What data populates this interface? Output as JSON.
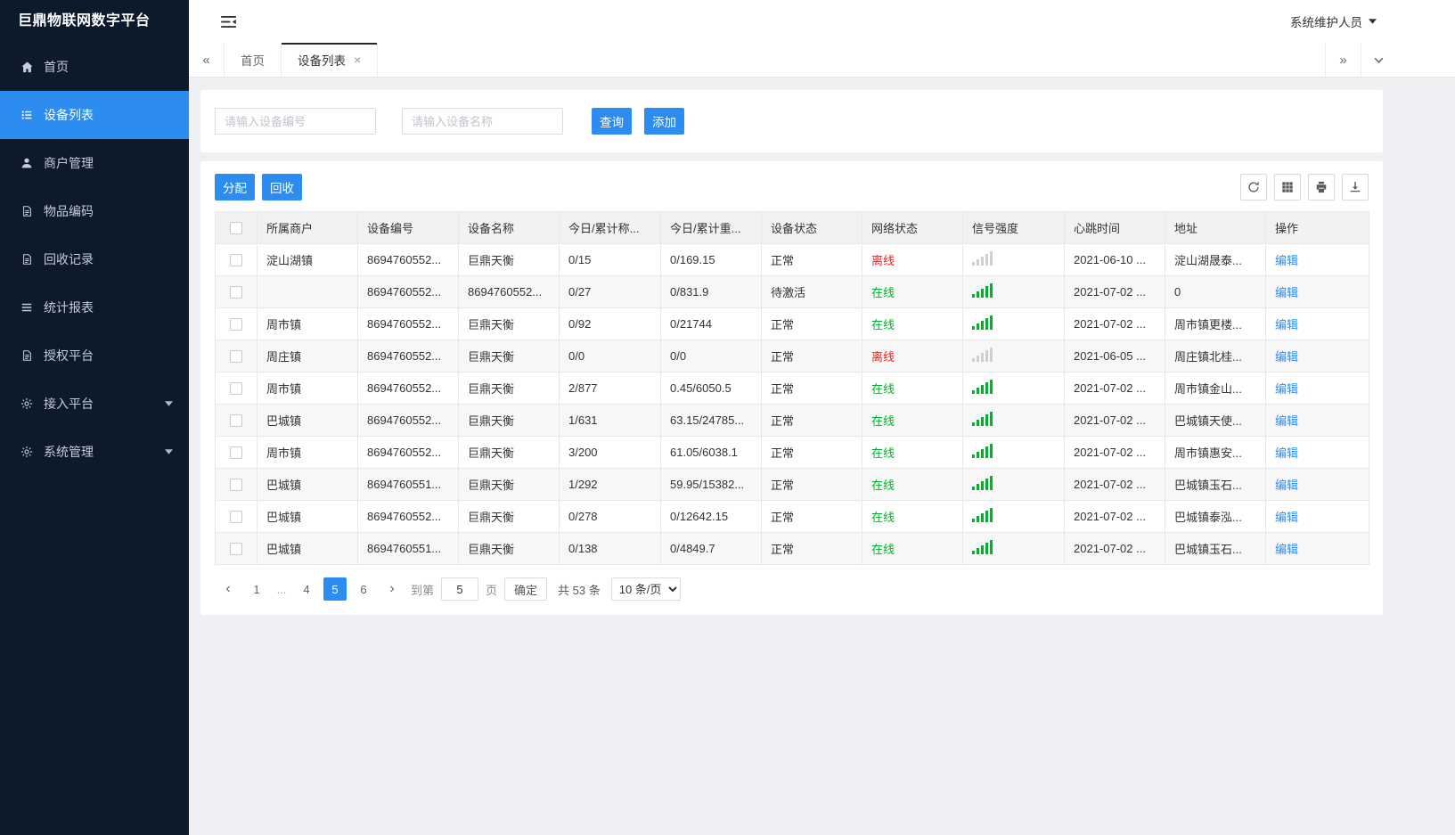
{
  "colors": {
    "accent": "#2d8cf0",
    "online": "#00b42a",
    "offline": "#ff1a1a",
    "sidebar_bg": "#0c1a2c"
  },
  "app": {
    "title": "巨鼎物联网数字平台",
    "user": "系统维护人员"
  },
  "sidebar": {
    "items": [
      {
        "label": "首页",
        "icon": "home",
        "active": false,
        "expandable": false
      },
      {
        "label": "设备列表",
        "icon": "list",
        "active": true,
        "expandable": false
      },
      {
        "label": "商户管理",
        "icon": "user",
        "active": false,
        "expandable": false
      },
      {
        "label": "物品编码",
        "icon": "doc",
        "active": false,
        "expandable": false
      },
      {
        "label": "回收记录",
        "icon": "doc",
        "active": false,
        "expandable": false
      },
      {
        "label": "统计报表",
        "icon": "lines",
        "active": false,
        "expandable": false
      },
      {
        "label": "授权平台",
        "icon": "doc",
        "active": false,
        "expandable": false
      },
      {
        "label": "接入平台",
        "icon": "gear",
        "active": false,
        "expandable": true
      },
      {
        "label": "系统管理",
        "icon": "gear",
        "active": false,
        "expandable": true
      }
    ]
  },
  "tabs": [
    {
      "label": "首页",
      "active": false,
      "closable": false
    },
    {
      "label": "设备列表",
      "active": true,
      "closable": true
    }
  ],
  "search": {
    "device_no_placeholder": "请输入设备编号",
    "device_name_placeholder": "请输入设备名称",
    "query_label": "查询",
    "add_label": "添加"
  },
  "toolbar": {
    "assign_label": "分配",
    "recycle_label": "回收",
    "icons": [
      "refresh",
      "columns",
      "print",
      "export"
    ]
  },
  "table": {
    "columns": [
      "所属商户",
      "设备编号",
      "设备名称",
      "今日/累计称...",
      "今日/累计重...",
      "设备状态",
      "网络状态",
      "信号强度",
      "心跳时间",
      "地址",
      "操作"
    ],
    "rows": [
      {
        "merchant": "淀山湖镇",
        "device_no": "8694760552...",
        "device_name": "巨鼎天衡",
        "count": "0/15",
        "weight": "0/169.15",
        "status": "正常",
        "network": "离线",
        "online": false,
        "heartbeat": "2021-06-10 ...",
        "address": "淀山湖晟泰...",
        "action": "编辑"
      },
      {
        "merchant": "",
        "device_no": "8694760552...",
        "device_name": "8694760552...",
        "count": "0/27",
        "weight": "0/831.9",
        "status": "待激活",
        "network": "在线",
        "online": true,
        "heartbeat": "2021-07-02 ...",
        "address": "0",
        "action": "编辑"
      },
      {
        "merchant": "周市镇",
        "device_no": "8694760552...",
        "device_name": "巨鼎天衡",
        "count": "0/92",
        "weight": "0/21744",
        "status": "正常",
        "network": "在线",
        "online": true,
        "heartbeat": "2021-07-02 ...",
        "address": "周市镇更楼...",
        "action": "编辑"
      },
      {
        "merchant": "周庄镇",
        "device_no": "8694760552...",
        "device_name": "巨鼎天衡",
        "count": "0/0",
        "weight": "0/0",
        "status": "正常",
        "network": "离线",
        "online": false,
        "heartbeat": "2021-06-05 ...",
        "address": "周庄镇北桂...",
        "action": "编辑"
      },
      {
        "merchant": "周市镇",
        "device_no": "8694760552...",
        "device_name": "巨鼎天衡",
        "count": "2/877",
        "weight": "0.45/6050.5",
        "status": "正常",
        "network": "在线",
        "online": true,
        "heartbeat": "2021-07-02 ...",
        "address": "周市镇金山...",
        "action": "编辑"
      },
      {
        "merchant": "巴城镇",
        "device_no": "8694760552...",
        "device_name": "巨鼎天衡",
        "count": "1/631",
        "weight": "63.15/24785...",
        "status": "正常",
        "network": "在线",
        "online": true,
        "heartbeat": "2021-07-02 ...",
        "address": "巴城镇天使...",
        "action": "编辑"
      },
      {
        "merchant": "周市镇",
        "device_no": "8694760552...",
        "device_name": "巨鼎天衡",
        "count": "3/200",
        "weight": "61.05/6038.1",
        "status": "正常",
        "network": "在线",
        "online": true,
        "heartbeat": "2021-07-02 ...",
        "address": "周市镇惠安...",
        "action": "编辑"
      },
      {
        "merchant": "巴城镇",
        "device_no": "8694760551...",
        "device_name": "巨鼎天衡",
        "count": "1/292",
        "weight": "59.95/15382...",
        "status": "正常",
        "network": "在线",
        "online": true,
        "heartbeat": "2021-07-02 ...",
        "address": "巴城镇玉石...",
        "action": "编辑"
      },
      {
        "merchant": "巴城镇",
        "device_no": "8694760552...",
        "device_name": "巨鼎天衡",
        "count": "0/278",
        "weight": "0/12642.15",
        "status": "正常",
        "network": "在线",
        "online": true,
        "heartbeat": "2021-07-02 ...",
        "address": "巴城镇泰泓...",
        "action": "编辑"
      },
      {
        "merchant": "巴城镇",
        "device_no": "8694760551...",
        "device_name": "巨鼎天衡",
        "count": "0/138",
        "weight": "0/4849.7",
        "status": "正常",
        "network": "在线",
        "online": true,
        "heartbeat": "2021-07-02 ...",
        "address": "巴城镇玉石...",
        "action": "编辑"
      }
    ]
  },
  "pagination": {
    "pages": [
      "1",
      "...",
      "4",
      "5",
      "6"
    ],
    "current": "5",
    "goto_label": "到第",
    "goto_value": "5",
    "page_label": "页",
    "confirm_label": "确定",
    "total_label": "共 53 条",
    "page_size": "10 条/页"
  }
}
